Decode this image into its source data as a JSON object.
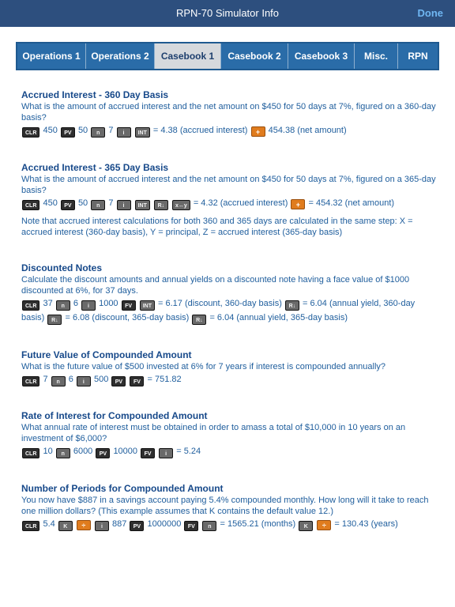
{
  "navbar": {
    "title": "RPN-70 Simulator Info",
    "done_label": "Done"
  },
  "tabs": [
    {
      "label": "Operations 1"
    },
    {
      "label": "Operations 2"
    },
    {
      "label": "Casebook 1"
    },
    {
      "label": "Casebook 2"
    },
    {
      "label": "Casebook 3"
    },
    {
      "label": "Misc."
    },
    {
      "label": "RPN"
    }
  ],
  "active_tab": "Casebook 1",
  "keys": {
    "clr": "CLR",
    "pv": "PV",
    "n": "n",
    "i": "i",
    "int": "INT",
    "rdown": "R↓",
    "xy": "x↔y",
    "plus": "+",
    "minus": "−",
    "divide": "÷",
    "fv": "FV",
    "k": "K"
  },
  "sections": [
    {
      "title": "Accrued Interest - 360 Day Basis",
      "text": "What is the amount of accrued interest and the net amount on $450 for 50 days at 7%, figured on a 360-day basis?",
      "v1": "450",
      "v2": "50",
      "v3": "7",
      "r1": "= 4.38 (accrued interest)",
      "r2": "454.38 (net amount)"
    },
    {
      "title": "Accrued Interest - 365 Day Basis",
      "text": "What is the amount of accrued interest and the net amount on $450 for 50 days at 7%, figured on a 365-day basis?",
      "v1": "450",
      "v2": "50",
      "v3": "7",
      "r1": "= 4.32 (accrued interest)",
      "r2": "= 454.32 (net amount)",
      "note": "Note that accrued interest calculations for both 360 and 365 days are calculated in the same step: X = accrued interest (360-day basis), Y = principal, Z = accrued interest (365-day basis)"
    },
    {
      "title": "Discounted Notes",
      "text": "Calculate the discount amounts and annual yields on a discounted note having a face value of $1000 discounted at 6%, for 37 days.",
      "v1": "37",
      "v2": "6",
      "v3": "1000",
      "r1": "= 6.17 (discount, 360-day basis)",
      "r2": "= 6.04 (annual yield, 360-day",
      "r3": "basis)",
      "r4": "= 6.08 (discount, 365-day basis)",
      "r5": "= 6.04 (annual yield, 365-day basis)"
    },
    {
      "title": "Future Value of Compounded Amount",
      "text": "What is the future value of $500 invested at 6% for 7 years if interest is compounded annually?",
      "v1": "7",
      "v2": "6",
      "v3": "500",
      "r1": "= 751.82"
    },
    {
      "title": "Rate of Interest for Compounded Amount",
      "text": "What annual rate of interest must be obtained in order to amass a total of $10,000 in 10 years on an investment of $6,000?",
      "v1": "10",
      "v2": "6000",
      "v3": "10000",
      "r1": "= 5.24"
    },
    {
      "title": "Number of Periods for Compounded Amount",
      "text": "You now have $887 in a savings account paying 5.4% compounded monthly. How long will it take to reach one million dollars? (This example assumes that K contains the default value 12.)",
      "v1": "5.4",
      "v2": "887",
      "v3": "1000000",
      "r1": "= 1565.21 (months)",
      "r2": "= 130.43 (years)"
    }
  ]
}
